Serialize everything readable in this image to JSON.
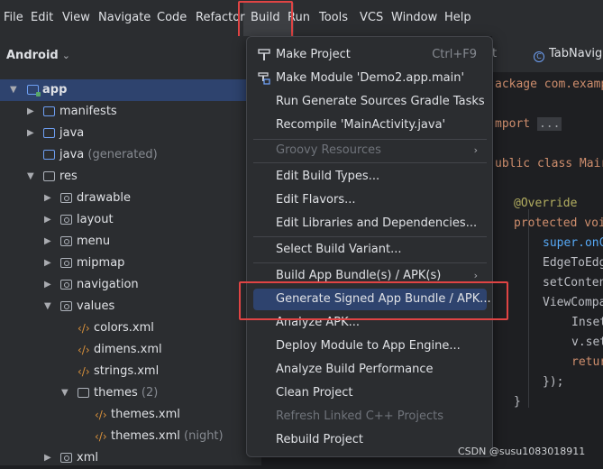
{
  "menubar": {
    "items": [
      "File",
      "Edit",
      "View",
      "Navigate",
      "Code",
      "Refactor",
      "Build",
      "Run",
      "Tools",
      "VCS",
      "Window",
      "Help"
    ]
  },
  "sidebar": {
    "title": "Android",
    "tree": [
      {
        "label": "app"
      },
      {
        "label": "manifests"
      },
      {
        "label": "java"
      },
      {
        "label": "java",
        "note": "(generated)"
      },
      {
        "label": "res"
      },
      {
        "label": "drawable"
      },
      {
        "label": "layout"
      },
      {
        "label": "menu"
      },
      {
        "label": "mipmap"
      },
      {
        "label": "navigation"
      },
      {
        "label": "values"
      },
      {
        "label": "colors.xml"
      },
      {
        "label": "dimens.xml"
      },
      {
        "label": "strings.xml"
      },
      {
        "label": "themes",
        "note": "(2)"
      },
      {
        "label": "themes.xml"
      },
      {
        "label": "themes.xml",
        "note": "(night)"
      },
      {
        "label": "xml"
      }
    ]
  },
  "editor": {
    "tab_stub": "t",
    "tab": "TabNavig",
    "lines": [
      "ackage com.examp",
      "mport",
      "...",
      "ublic class Mair",
      "@Override",
      "protected voi",
      "super.onC",
      "EdgeToEdg",
      "setConten",
      "ViewCompa",
      "Inset",
      "v.set",
      "retur",
      "});",
      "}"
    ]
  },
  "build_menu": {
    "items": [
      {
        "label": "Make Project",
        "shortcut": "Ctrl+F9"
      },
      {
        "label": "Make Module 'Demo2.app.main'"
      },
      {
        "label": "Run Generate Sources Gradle Tasks"
      },
      {
        "label": "Recompile 'MainActivity.java'"
      },
      {
        "label": "Groovy Resources",
        "submenu_arrow": "›"
      },
      {
        "label": "Edit Build Types..."
      },
      {
        "label": "Edit Flavors..."
      },
      {
        "label": "Edit Libraries and Dependencies..."
      },
      {
        "label": "Select Build Variant..."
      },
      {
        "label": "Build App Bundle(s) / APK(s)",
        "submenu_arrow": "›"
      },
      {
        "label": "Generate Signed App Bundle / APK..."
      },
      {
        "label": "Analyze APK..."
      },
      {
        "label": "Deploy Module to App Engine..."
      },
      {
        "label": "Analyze Build Performance"
      },
      {
        "label": "Clean Project"
      },
      {
        "label": "Refresh Linked C++ Projects"
      },
      {
        "label": "Rebuild Project"
      }
    ]
  },
  "watermark": "CSDN @susu1083018911",
  "colors": {
    "highlight_box": "#e04444",
    "selection": "#2e436e",
    "accent_blue": "#6e9ff3"
  }
}
